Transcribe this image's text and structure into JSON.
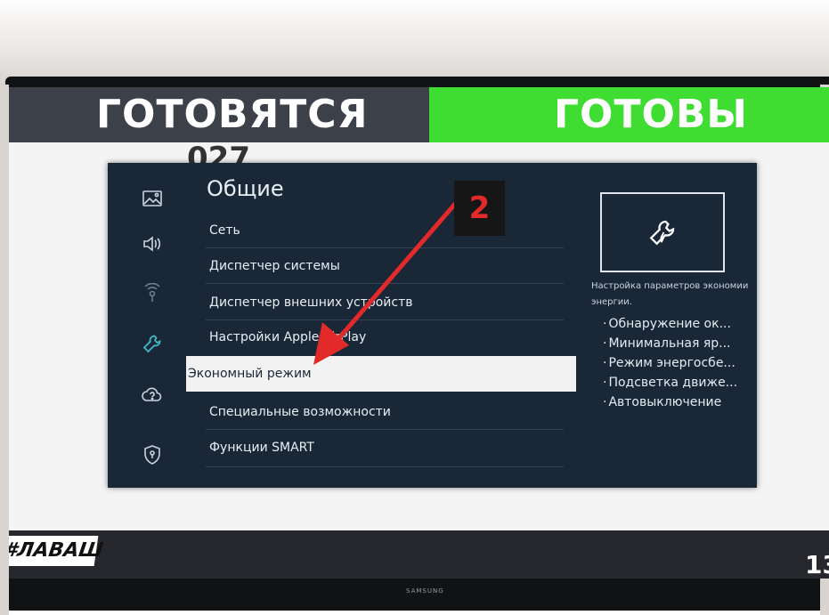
{
  "board": {
    "preparing_label": "ГОТОВЯТСЯ",
    "ready_label": "ГОТОВЫ",
    "order_number": "027",
    "brand_tag": "#ЛАВАШ",
    "clock": "13",
    "tv_brand": "SAMSUNG"
  },
  "rail_icons": [
    {
      "name": "picture-icon"
    },
    {
      "name": "sound-icon"
    },
    {
      "name": "broadcast-icon"
    },
    {
      "name": "wrench-icon",
      "active": true
    },
    {
      "name": "support-icon"
    },
    {
      "name": "privacy-shield-icon"
    }
  ],
  "menu": {
    "title": "Общие",
    "items": [
      {
        "label": "Сеть"
      },
      {
        "label": "Диспетчер системы"
      },
      {
        "label": "Диспетчер внешних устройств"
      },
      {
        "label": "Настройки Apple AirPlay"
      },
      {
        "label": "Экономный режим",
        "selected": true
      },
      {
        "label": "Специальные возможности"
      },
      {
        "label": "Функции SMART"
      }
    ]
  },
  "info_panel": {
    "description": "Настройка параметров экономии энергии.",
    "features": [
      "Обнаружение ок...",
      "Минимальная яр...",
      "Режим энергосбе...",
      "Подсветка движе...",
      "Автовыключение"
    ]
  },
  "annotation": {
    "step_number": "2",
    "color": "#e32a2a"
  }
}
